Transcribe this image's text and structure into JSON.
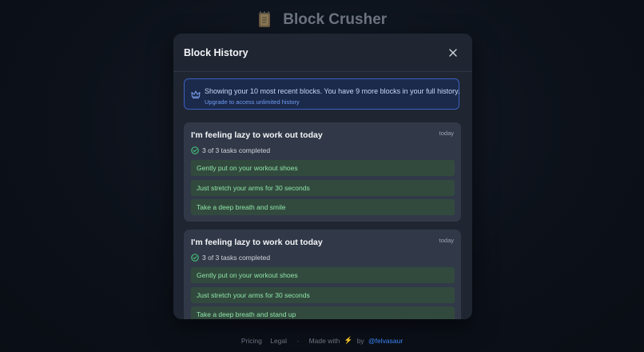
{
  "app": {
    "title": "Block Crusher",
    "logo_icon": "notebook-icon"
  },
  "modal": {
    "title": "Block History",
    "close_icon": "close-icon",
    "notice": {
      "icon": "crown-icon",
      "text": "Showing your 10 most recent blocks. You have 9 more blocks in your full history.",
      "link": "Upgrade to access unlimited history"
    },
    "history": [
      {
        "title": "I'm feeling lazy to work out today",
        "date": "today",
        "progress": "3 of 3 tasks completed",
        "tasks": [
          "Gently put on your workout shoes",
          "Just stretch your arms for 30 seconds",
          "Take a deep breath and smile"
        ]
      },
      {
        "title": "I'm feeling lazy to work out today",
        "date": "today",
        "progress": "3 of 3 tasks completed",
        "tasks": [
          "Gently put on your workout shoes",
          "Just stretch your arms for 30 seconds",
          "Take a deep breath and stand up"
        ]
      }
    ]
  },
  "footer": {
    "pricing": "Pricing",
    "legal": "Legal",
    "separator": "·",
    "made_with": "Made with",
    "bolt": "⚡",
    "by": "by",
    "author": "@felvasaur"
  },
  "colors": {
    "accent_blue": "#3b82f6",
    "task_green": "#8de3a6",
    "notice_border": "#3b5fbf"
  }
}
